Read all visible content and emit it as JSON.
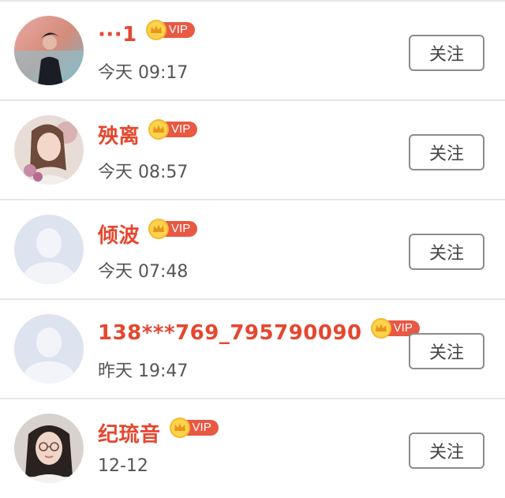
{
  "users": [
    {
      "name": "···1",
      "vip_label": "VIP",
      "time": "今天 09:17",
      "follow_label": "关注",
      "avatar": "photo-dark-coat"
    },
    {
      "name": "殃离",
      "vip_label": "VIP",
      "time": "今天 08:57",
      "follow_label": "关注",
      "avatar": "photo-woman-flowers"
    },
    {
      "name": "倾波",
      "vip_label": "VIP",
      "time": "今天 07:48",
      "follow_label": "关注",
      "avatar": "default-silhouette"
    },
    {
      "name": "138***769_795790090",
      "vip_label": "VIP",
      "time": "昨天 19:47",
      "follow_label": "关注",
      "avatar": "default-silhouette"
    },
    {
      "name": "纪琉音",
      "vip_label": "VIP",
      "time": "12-12",
      "follow_label": "关注",
      "avatar": "photo-woman-glasses"
    }
  ],
  "colors": {
    "name": "#e5472f",
    "vip_tag": "#e85843",
    "crown": "#f5b82e",
    "divider": "#e6e6e6"
  }
}
